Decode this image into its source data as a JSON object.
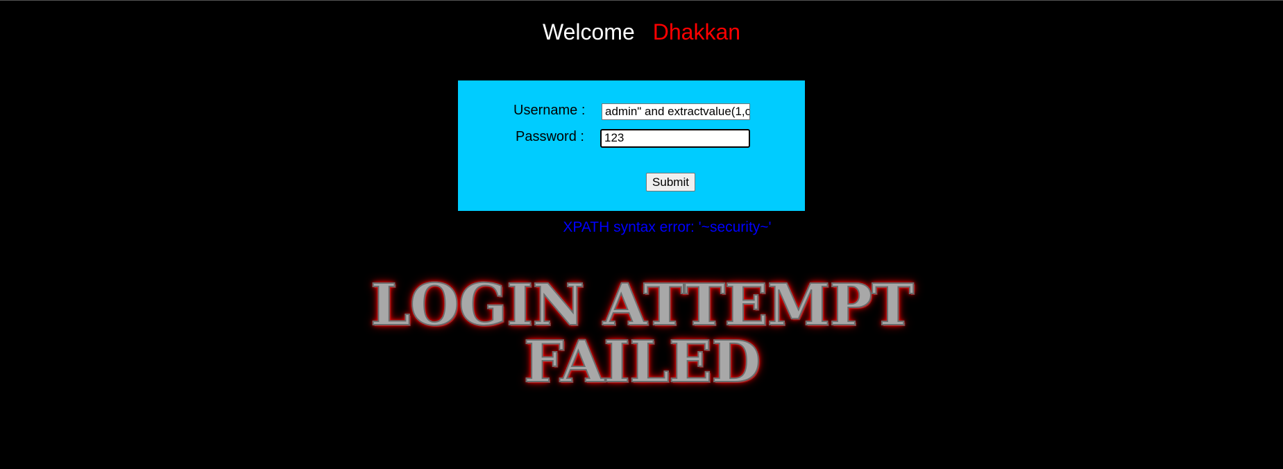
{
  "header": {
    "welcome_label": "Welcome",
    "user_name": "Dhakkan"
  },
  "login_form": {
    "username_label": "Username :",
    "username_value": "admin\" and extractvalue(1,c",
    "password_label": "Password :",
    "password_value": "123",
    "submit_label": "Submit"
  },
  "result": {
    "error_message": "XPATH syntax error: '~security~'",
    "banner_line_1": "LOGIN ATTEMPT",
    "banner_line_2": "FAILED"
  },
  "colors": {
    "background": "#000000",
    "form_background": "#00ccff",
    "welcome_name": "#ff0000",
    "error_text": "#0000ff"
  }
}
